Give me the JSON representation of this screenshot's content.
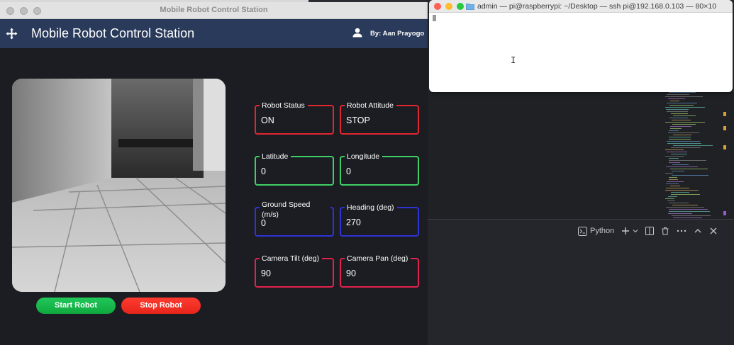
{
  "app": {
    "window_title": "Mobile Robot Control Station",
    "header_title": "Mobile Robot Control Station",
    "author": "By: Aan Prayogo",
    "fields": [
      {
        "id": "robot-status",
        "label": "Robot Status",
        "value": "ON",
        "color": "#e0272f"
      },
      {
        "id": "robot-attitude",
        "label": "Robot Attitude",
        "value": "STOP",
        "color": "#e0272f"
      },
      {
        "id": "latitude",
        "label": "Latitude",
        "value": "0",
        "color": "#3fcf65"
      },
      {
        "id": "longitude",
        "label": "Longitude",
        "value": "0",
        "color": "#3fcf65"
      },
      {
        "id": "ground-speed",
        "label": "Ground Speed (m/s)",
        "value": "0",
        "color": "#2e34d6"
      },
      {
        "id": "heading",
        "label": "Heading (deg)",
        "value": "270",
        "color": "#2e34d6"
      },
      {
        "id": "camera-tilt",
        "label": "Camera Tilt (deg)",
        "value": "90",
        "color": "#e2224d"
      },
      {
        "id": "camera-pan",
        "label": "Camera Pan (deg)",
        "value": "90",
        "color": "#e2224d"
      }
    ],
    "buttons": {
      "start": "Start Robot",
      "stop": "Stop Robot"
    },
    "colors": {
      "header_bg": "#2a3a5a",
      "start_button": "#17b94c",
      "stop_button": "#f5302a"
    }
  },
  "terminal": {
    "title": "admin — pi@raspberrypi: ~/Desktop — ssh pi@192.168.0.103 — 80×10"
  },
  "editor_panel": {
    "terminal_profile": "Python"
  },
  "icons": {
    "header_menu": "move-arrows-icon",
    "author": "user-icon",
    "terminal_folder": "folder-icon"
  }
}
